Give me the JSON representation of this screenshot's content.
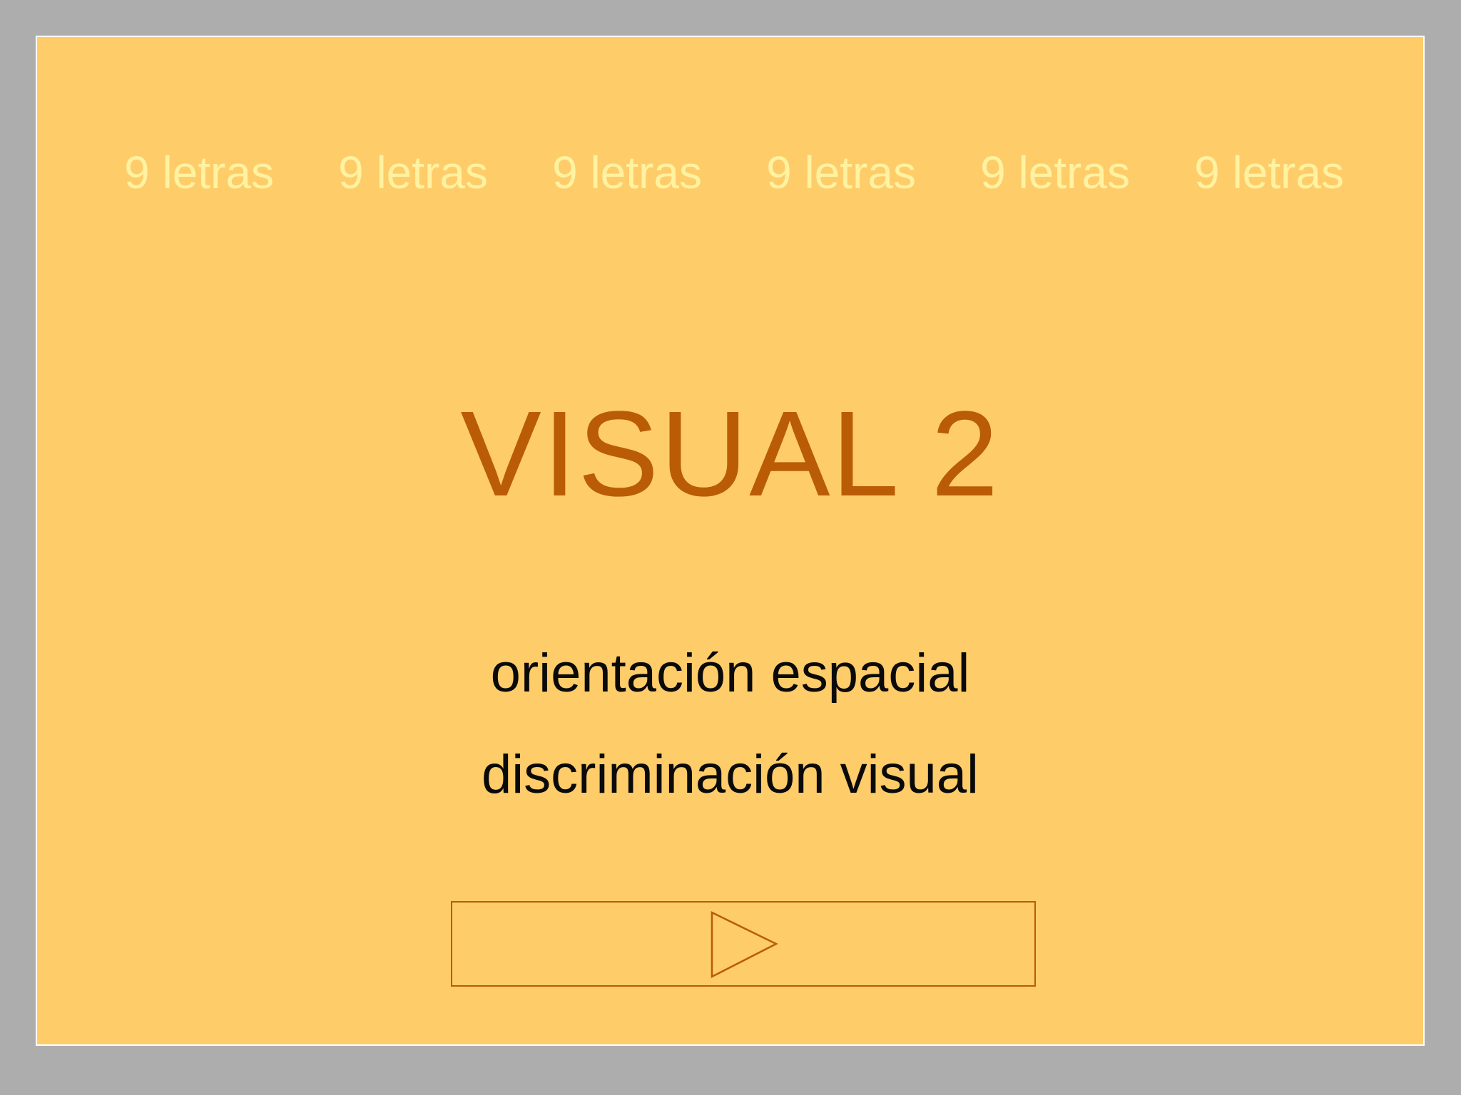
{
  "tabs": [
    {
      "label": "9 letras"
    },
    {
      "label": "9 letras"
    },
    {
      "label": "9 letras"
    },
    {
      "label": "9 letras"
    },
    {
      "label": "9 letras"
    },
    {
      "label": "9 letras"
    }
  ],
  "title": "VISUAL 2",
  "subtitles": [
    "orientación espacial",
    "discriminación visual"
  ],
  "play_button": {
    "icon": "play-icon"
  },
  "colors": {
    "page_background": "#adadad",
    "slide_background": "#ffcc6a",
    "tab_text": "#fff2a0",
    "title": "#b95c05",
    "subtitle": "#0a0a0a",
    "button_border": "#b95c05"
  }
}
